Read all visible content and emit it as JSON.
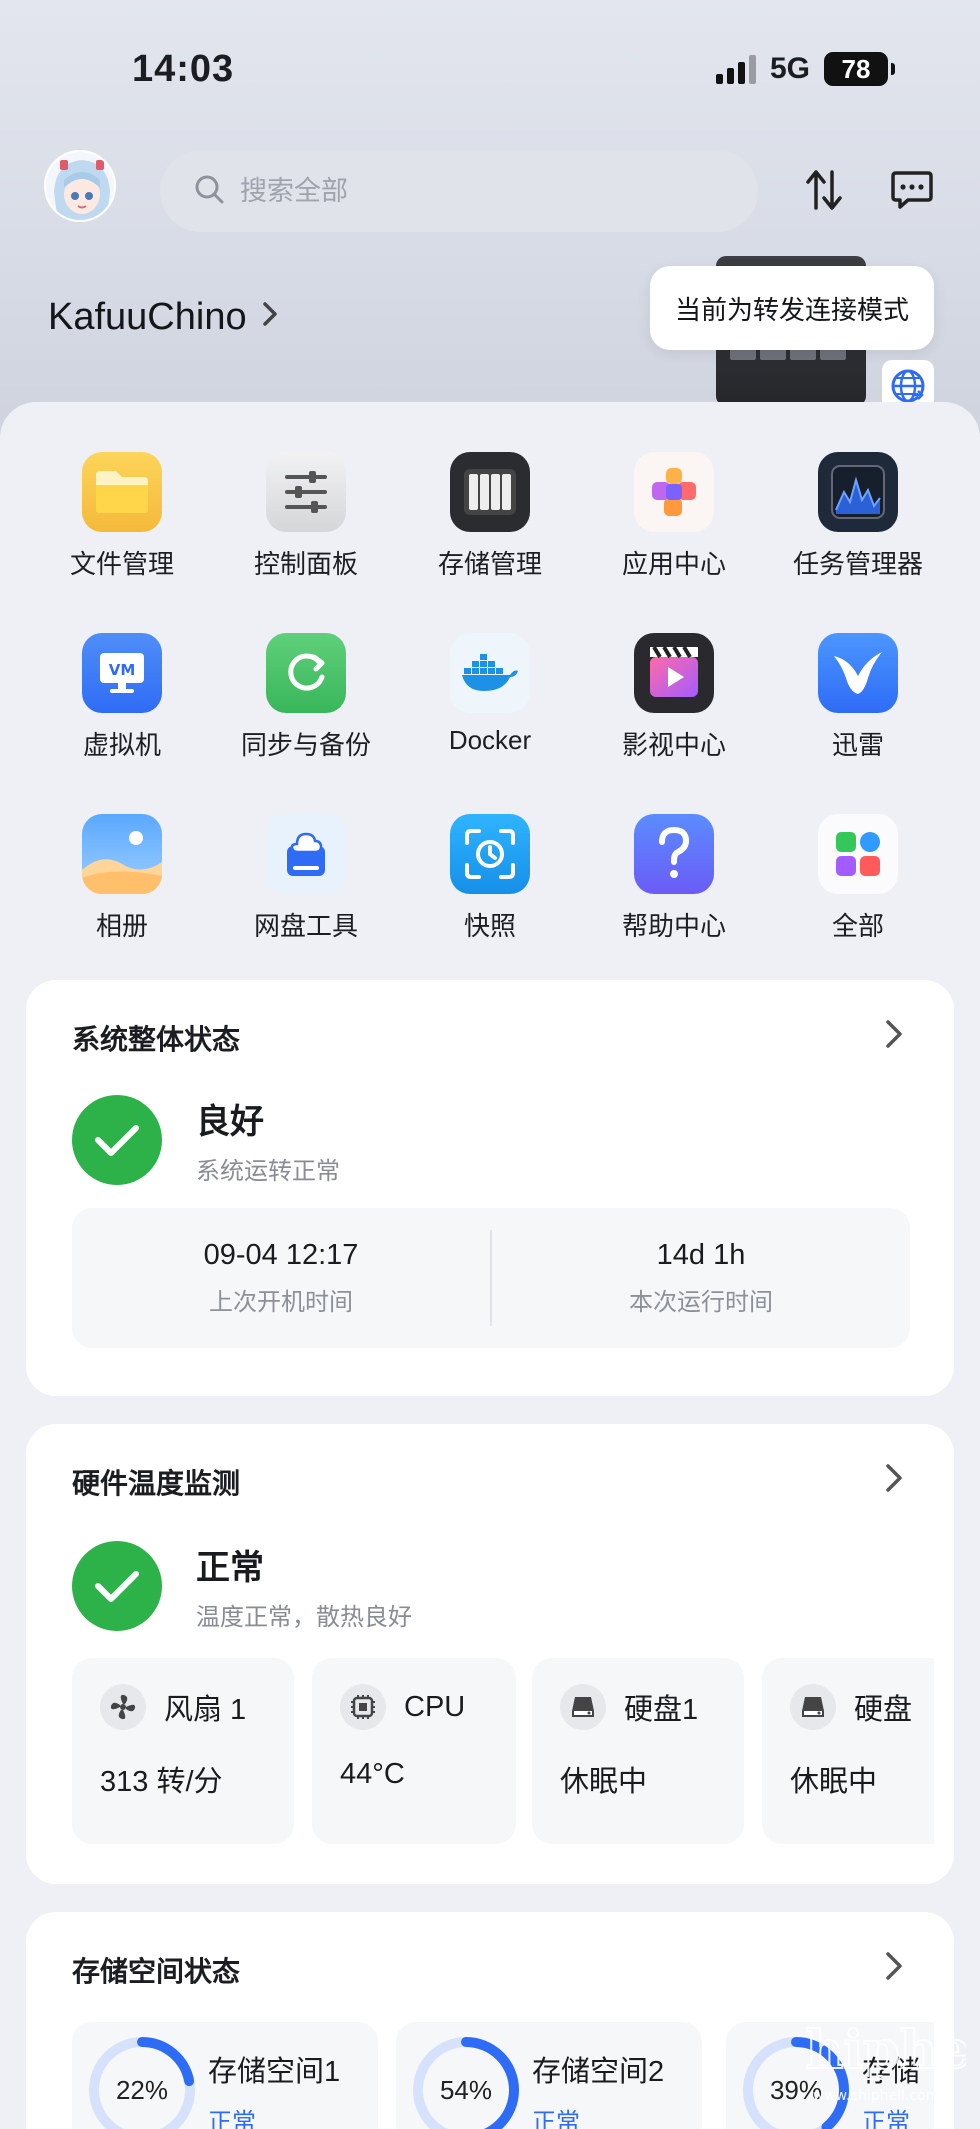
{
  "status_bar": {
    "time": "14:03",
    "network": "5G",
    "battery": "78"
  },
  "header": {
    "search_placeholder": "搜索全部"
  },
  "user": {
    "name": "KafuuChino"
  },
  "tooltip": {
    "text": "当前为转发连接模式"
  },
  "apps": [
    {
      "label": "文件管理",
      "icon": "folder-icon"
    },
    {
      "label": "控制面板",
      "icon": "sliders-icon"
    },
    {
      "label": "存储管理",
      "icon": "storage-icon"
    },
    {
      "label": "应用中心",
      "icon": "app-center-icon"
    },
    {
      "label": "任务管理器",
      "icon": "task-monitor-icon"
    },
    {
      "label": "虚拟机",
      "icon": "vm-icon"
    },
    {
      "label": "同步与备份",
      "icon": "sync-icon"
    },
    {
      "label": "Docker",
      "icon": "docker-icon"
    },
    {
      "label": "影视中心",
      "icon": "video-icon"
    },
    {
      "label": "迅雷",
      "icon": "thunder-icon"
    },
    {
      "label": "相册",
      "icon": "photo-icon"
    },
    {
      "label": "网盘工具",
      "icon": "cloud-drive-icon"
    },
    {
      "label": "快照",
      "icon": "snapshot-icon"
    },
    {
      "label": "帮助中心",
      "icon": "help-icon"
    },
    {
      "label": "全部",
      "icon": "all-apps-icon"
    }
  ],
  "system_status": {
    "title": "系统整体状态",
    "state": "良好",
    "description": "系统运转正常",
    "last_boot": {
      "value": "09-04 12:17",
      "label": "上次开机时间"
    },
    "uptime": {
      "value": "14d 1h",
      "label": "本次运行时间"
    }
  },
  "temperature": {
    "title": "硬件温度监测",
    "state": "正常",
    "description": "温度正常，散热良好",
    "sensors": [
      {
        "name": "风扇 1",
        "value": "313 转/分",
        "icon": "fan-icon"
      },
      {
        "name": "CPU",
        "value": "44°C",
        "icon": "cpu-icon"
      },
      {
        "name": "硬盘1",
        "value": "休眠中",
        "icon": "disk-icon"
      },
      {
        "name": "硬盘",
        "value": "休眠中",
        "icon": "disk-icon"
      }
    ]
  },
  "storage": {
    "title": "存储空间状态",
    "pools": [
      {
        "name": "存储空间1",
        "percent": "22%",
        "usage": 0.22,
        "state": "正常"
      },
      {
        "name": "存储空间2",
        "percent": "54%",
        "usage": 0.54,
        "state": "正常"
      },
      {
        "name": "存储",
        "percent": "39%",
        "usage": 0.39,
        "state": "正常"
      }
    ]
  },
  "watermark": {
    "text": "chiphell",
    "url": "www.chiphell.com"
  },
  "colors": {
    "accent": "#2f6cf6",
    "good": "#2db24a",
    "card": "#ffffff",
    "background": "#eef0f6"
  }
}
